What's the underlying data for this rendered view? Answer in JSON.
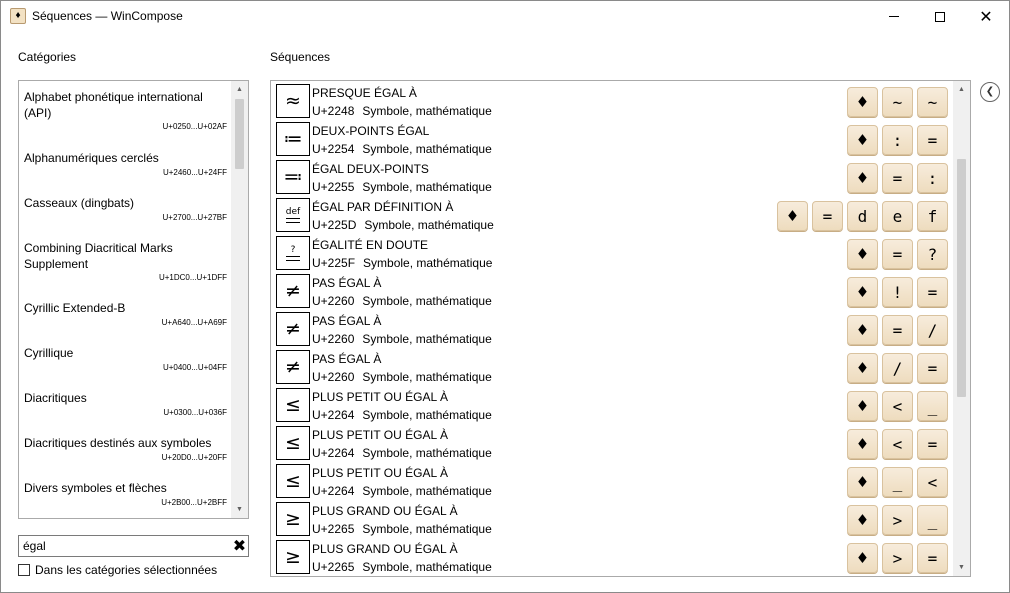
{
  "window": {
    "title": "Séquences — WinCompose",
    "app_icon": "♦",
    "minimize_icon": "minimize-icon",
    "maximize_icon": "maximize-icon",
    "close_glyph": "✕"
  },
  "categories": {
    "heading": "Catégories",
    "items": [
      {
        "name": "Alphabet phonétique international (API)",
        "range": "U+0250...U+02AF"
      },
      {
        "name": "Alphanumériques cerclés",
        "range": "U+2460...U+24FF"
      },
      {
        "name": "Casseaux (dingbats)",
        "range": "U+2700...U+27BF"
      },
      {
        "name": "Combining Diacritical Marks Supplement",
        "range": "U+1DC0...U+1DFF"
      },
      {
        "name": "Cyrillic Extended-B",
        "range": "U+A640...U+A69F"
      },
      {
        "name": "Cyrillique",
        "range": "U+0400...U+04FF"
      },
      {
        "name": "Diacritiques",
        "range": "U+0300...U+036F"
      },
      {
        "name": "Diacritiques destinés aux symboles",
        "range": "U+20D0...U+20FF"
      },
      {
        "name": "Divers symboles et flèches",
        "range": "U+2B00...U+2BFF"
      }
    ]
  },
  "search": {
    "value": "égal",
    "clear_glyph": "✖",
    "filter_label": "Dans les catégories sélectionnées",
    "filter_checked": false
  },
  "sequences": {
    "heading": "Séquences",
    "compose_key": "♦",
    "items": [
      {
        "glyph": "≈",
        "name": "PRESQUE ÉGAL À",
        "code": "U+2248",
        "category": "Symbole, mathématique",
        "keys": [
          "~",
          "~"
        ]
      },
      {
        "glyph": "≔",
        "name": "DEUX-POINTS ÉGAL",
        "code": "U+2254",
        "category": "Symbole, mathématique",
        "keys": [
          ":",
          "="
        ]
      },
      {
        "glyph": "≕",
        "name": "ÉGAL DEUX-POINTS",
        "code": "U+2255",
        "category": "Symbole, mathématique",
        "keys": [
          "=",
          ":"
        ]
      },
      {
        "glyph": "def",
        "name": "ÉGAL PAR DÉFINITION À",
        "code": "U+225D",
        "category": "Symbole, mathématique",
        "keys": [
          "=",
          "d",
          "e",
          "f"
        ]
      },
      {
        "glyph": "?",
        "name": "ÉGALITÉ EN DOUTE",
        "code": "U+225F",
        "category": "Symbole, mathématique",
        "keys": [
          "=",
          "?"
        ]
      },
      {
        "glyph": "≠",
        "name": "PAS ÉGAL À",
        "code": "U+2260",
        "category": "Symbole, mathématique",
        "keys": [
          "!",
          "="
        ]
      },
      {
        "glyph": "≠",
        "name": "PAS ÉGAL À",
        "code": "U+2260",
        "category": "Symbole, mathématique",
        "keys": [
          "=",
          "/"
        ]
      },
      {
        "glyph": "≠",
        "name": "PAS ÉGAL À",
        "code": "U+2260",
        "category": "Symbole, mathématique",
        "keys": [
          "/",
          "="
        ]
      },
      {
        "glyph": "≤",
        "name": "PLUS PETIT OU ÉGAL À",
        "code": "U+2264",
        "category": "Symbole, mathématique",
        "keys": [
          "<",
          "_"
        ]
      },
      {
        "glyph": "≤",
        "name": "PLUS PETIT OU ÉGAL À",
        "code": "U+2264",
        "category": "Symbole, mathématique",
        "keys": [
          "<",
          "="
        ]
      },
      {
        "glyph": "≤",
        "name": "PLUS PETIT OU ÉGAL À",
        "code": "U+2264",
        "category": "Symbole, mathématique",
        "keys": [
          "_",
          "<"
        ]
      },
      {
        "glyph": "≥",
        "name": "PLUS GRAND OU ÉGAL À",
        "code": "U+2265",
        "category": "Symbole, mathématique",
        "keys": [
          ">",
          "_"
        ]
      },
      {
        "glyph": "≥",
        "name": "PLUS GRAND OU ÉGAL À",
        "code": "U+2265",
        "category": "Symbole, mathématique",
        "keys": [
          ">",
          "="
        ]
      }
    ]
  },
  "side_panel": {
    "toggle_glyph": "❮"
  }
}
